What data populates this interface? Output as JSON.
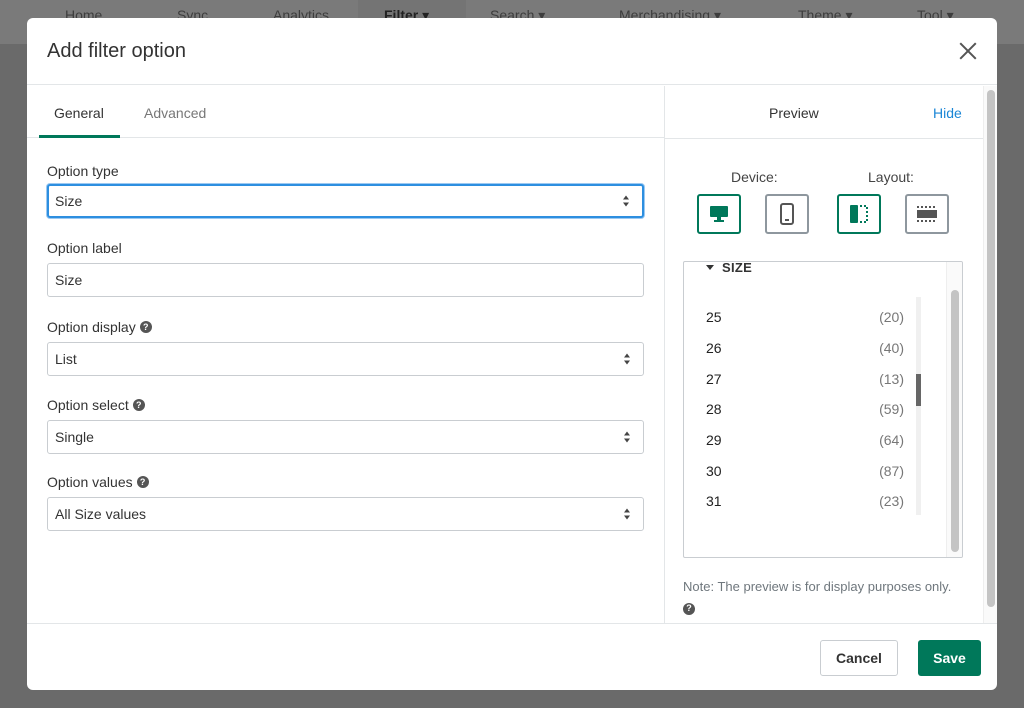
{
  "background_nav": {
    "items": [
      {
        "label": "Home",
        "has_caret": false
      },
      {
        "label": "Sync",
        "has_caret": false
      },
      {
        "label": "Analytics",
        "has_caret": false
      },
      {
        "label": "Filter ▾",
        "has_caret": true,
        "active": true
      },
      {
        "label": "Search ▾",
        "has_caret": true
      },
      {
        "label": "Merchandising ▾",
        "has_caret": true
      },
      {
        "label": "Theme ▾",
        "has_caret": true
      },
      {
        "label": "Tool ▾",
        "has_caret": true
      }
    ]
  },
  "modal": {
    "title": "Add filter option",
    "close_icon": "close-icon"
  },
  "tabs": [
    {
      "label": "General",
      "active": true
    },
    {
      "label": "Advanced",
      "active": false
    }
  ],
  "form": {
    "option_type": {
      "label": "Option type",
      "value": "Size"
    },
    "option_label": {
      "label": "Option label",
      "value": "Size"
    },
    "option_display": {
      "label": "Option display",
      "value": "List",
      "help": "?"
    },
    "option_select": {
      "label": "Option select",
      "value": "Single",
      "help": "?"
    },
    "option_values": {
      "label": "Option values",
      "value": "All Size values",
      "help": "?"
    }
  },
  "preview": {
    "title": "Preview",
    "hide_label": "Hide",
    "device_label": "Device:",
    "layout_label": "Layout:",
    "device_options": [
      {
        "icon": "desktop-icon",
        "active": true
      },
      {
        "icon": "mobile-icon",
        "active": false
      }
    ],
    "layout_options": [
      {
        "icon": "layout-sidebar-icon",
        "active": true
      },
      {
        "icon": "layout-horizontal-icon",
        "active": false
      }
    ],
    "facet": {
      "title": "SIZE",
      "items": [
        {
          "value": "25",
          "count": "(20)"
        },
        {
          "value": "26",
          "count": "(40)"
        },
        {
          "value": "27",
          "count": "(13)"
        },
        {
          "value": "28",
          "count": "(59)"
        },
        {
          "value": "29",
          "count": "(64)"
        },
        {
          "value": "30",
          "count": "(87)"
        },
        {
          "value": "31",
          "count": "(23)"
        }
      ]
    },
    "note": "Note: The preview is for display purposes only.",
    "note_help": "?"
  },
  "footer": {
    "cancel_label": "Cancel",
    "save_label": "Save"
  },
  "colors": {
    "accent": "#00785a",
    "link": "#1a86d6",
    "focus": "#2d8fe0"
  }
}
